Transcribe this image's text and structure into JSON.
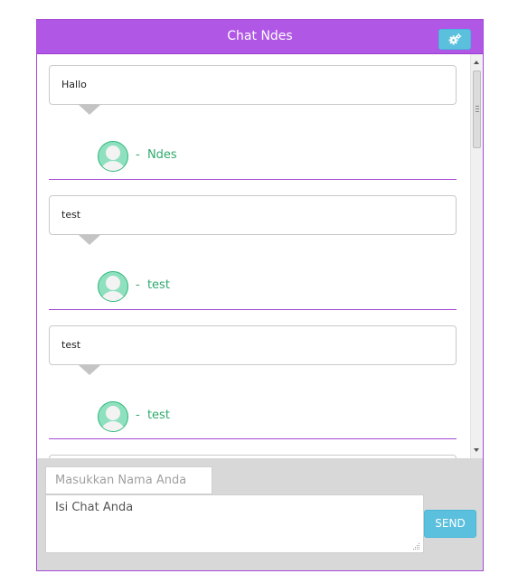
{
  "header": {
    "title": "Chat Ndes",
    "settings_icon": "gears-icon"
  },
  "messages": [
    {
      "text": "Hallo",
      "author": "-  Ndes"
    },
    {
      "text": "test",
      "author": "-  test"
    },
    {
      "text": "test",
      "author": "-  test"
    }
  ],
  "form": {
    "name_placeholder": "Masukkan Nama Anda",
    "chat_placeholder": "Isi Chat Anda",
    "send_label": "SEND"
  },
  "colors": {
    "header": "#b057e6",
    "accent": "#5bc0de",
    "author": "#2eaa6d",
    "separator": "#a64ad4"
  }
}
